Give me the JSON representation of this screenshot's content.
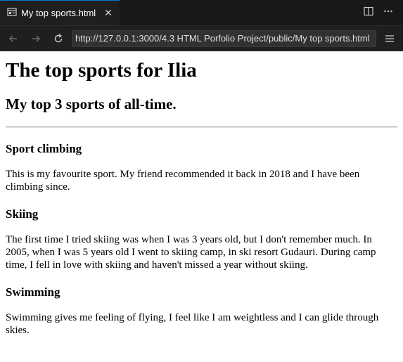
{
  "tab": {
    "title": "My top sports.html"
  },
  "address_bar": {
    "url": "http://127.0.0.1:3000/4.3 HTML Porfolio Project/public/My top sports.html"
  },
  "page": {
    "title": "The top sports for Ilia",
    "subtitle": "My top 3 sports of all-time.",
    "sports": [
      {
        "name": "Sport climbing",
        "description": "This is my favourite sport. My friend recommended it back in 2018 and I have been climbing since."
      },
      {
        "name": "Skiing",
        "description": "The first time I tried skiing was when I was 3 years old, but I don't remember much. In 2005, when I was 5 years old I went to skiing camp, in ski resort Gudauri. During camp time, I fell in love with skiing and haven't missed a year without skiing."
      },
      {
        "name": "Swimming",
        "description": "Swimming gives me feeling of flying, I feel like I am weightless and I can glide through skies."
      }
    ]
  },
  "icons": {
    "tab": "preview-icon",
    "close": "close-icon",
    "split": "split-editor-icon",
    "more": "more-actions-icon",
    "back": "back-arrow-icon",
    "forward": "forward-arrow-icon",
    "reload": "reload-icon",
    "menu": "menu-icon"
  }
}
